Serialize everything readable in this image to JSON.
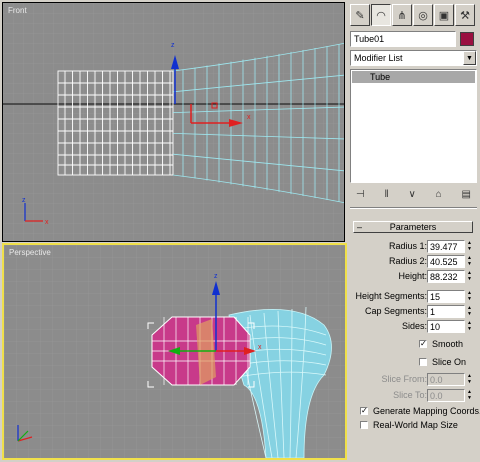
{
  "viewports": {
    "front_label": "Front",
    "perspective_label": "Perspective",
    "axis_x": "x",
    "axis_y": "y",
    "axis_z": "z"
  },
  "panel": {
    "tabs": [
      "create-icon",
      "modify-icon",
      "hierarchy-icon",
      "motion-icon",
      "display-icon",
      "utilities-icon"
    ],
    "object_name": "Tube01",
    "object_color": "#9a1040",
    "modifier_list": "Modifier List",
    "stack_items": [
      "Tube"
    ],
    "rollout_title": "Parameters",
    "params": {
      "radius1_label": "Radius 1:",
      "radius1": "39.477",
      "radius2_label": "Radius 2:",
      "radius2": "40.525",
      "height_label": "Height:",
      "height": "88.232",
      "height_segments_label": "Height Segments:",
      "height_segments": "15",
      "cap_segments_label": "Cap Segments:",
      "cap_segments": "1",
      "sides_label": "Sides:",
      "sides": "10",
      "smooth_label": "Smooth",
      "smooth": true,
      "slice_on_label": "Slice On",
      "slice_on": false,
      "slice_from_label": "Slice From:",
      "slice_from": "0.0",
      "slice_to_label": "Slice To:",
      "slice_to": "0.0",
      "gen_mapping_label": "Generate Mapping Coords.",
      "gen_mapping": true,
      "real_world_label": "Real-World Map Size",
      "real_world": false
    }
  },
  "colors": {
    "viewport_bg": "#8c8c8c",
    "active_border": "#f0e04a",
    "wire_white": "#ffffff",
    "wire_cyan": "#9ee8f0",
    "axis_red": "#e02020",
    "axis_blue": "#1030d0",
    "axis_green": "#10b010"
  }
}
